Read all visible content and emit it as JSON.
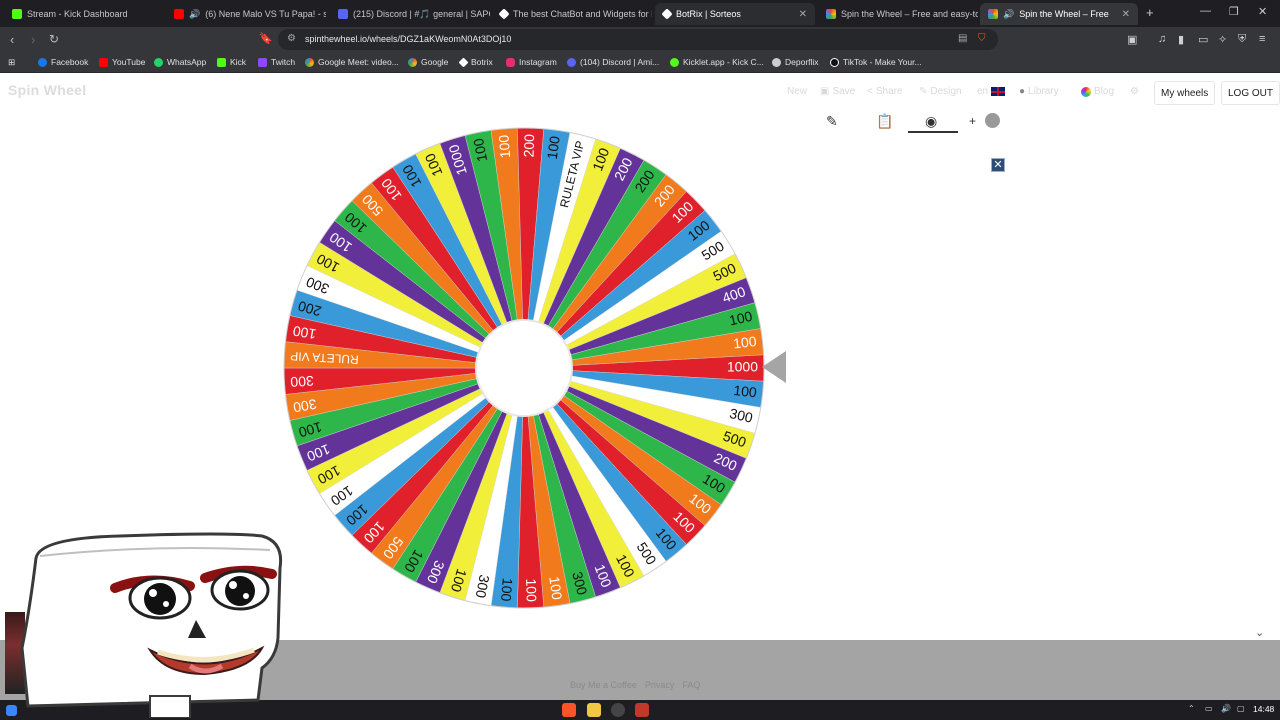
{
  "browser": {
    "tabs": [
      {
        "title": "Stream - Kick Dashboard",
        "color": "#53fc18"
      },
      {
        "title": "(6) Nene Malo VS Tu Papa! - sus",
        "color": "#ff0000"
      },
      {
        "title": "(215) Discord | #🎵 general | SAPO",
        "color": "#5865f2"
      },
      {
        "title": "The best ChatBot and Widgets for K",
        "color": "#ffffff"
      },
      {
        "title": "BotRix | Sorteos",
        "color": "#ffffff"
      },
      {
        "title": "Spin the Wheel – Free and easy-to-u",
        "color": "#4285f4"
      },
      {
        "title": "Spin the Wheel – Free and e",
        "color": "#ea4335"
      }
    ],
    "url": "spinthewheel.io/wheels/DGZ1aKWeomN0At3DOj10",
    "bookmarks": [
      {
        "label": "Facebook",
        "color": "#1877f2"
      },
      {
        "label": "YouTube",
        "color": "#ff0000"
      },
      {
        "label": "WhatsApp",
        "color": "#25d366"
      },
      {
        "label": "Kick",
        "color": "#53fc18"
      },
      {
        "label": "Twitch",
        "color": "#9146ff"
      },
      {
        "label": "Google Meet: video...",
        "color": "#00897b"
      },
      {
        "label": "Google",
        "color": "#4285f4"
      },
      {
        "label": "Botrix",
        "color": "#ffffff"
      },
      {
        "label": "Instagram",
        "color": "#e1306c"
      },
      {
        "label": "(104) Discord | Ami...",
        "color": "#5865f2"
      },
      {
        "label": "Kicklet.app - Kick C...",
        "color": "#53fc18"
      },
      {
        "label": "Deporflix",
        "color": "#cccccc"
      },
      {
        "label": "TikTok - Make Your...",
        "color": "#ffffff"
      }
    ]
  },
  "site": {
    "logo": "Spin Wheel",
    "menu": {
      "new": "New",
      "save": "Save",
      "share": "Share",
      "design": "Design",
      "lang": "en",
      "library": "Library",
      "blog": "Blog"
    },
    "my_wheels": "My wheels",
    "log_out": "LOG OUT",
    "footer": {
      "coffee": "Buy Me a Coffee",
      "privacy": "Privacy",
      "faq": "FAQ"
    }
  },
  "taskbar": {
    "time": "14:48"
  },
  "wheel": {
    "segments": [
      {
        "label": "1000",
        "color": "#e0202a"
      },
      {
        "label": "100",
        "color": "#3a9ad9"
      },
      {
        "label": "300",
        "color": "#ffffff"
      },
      {
        "label": "500",
        "color": "#f2ef3a"
      },
      {
        "label": "200",
        "color": "#63339a"
      },
      {
        "label": "100",
        "color": "#2fb64a"
      },
      {
        "label": "100",
        "color": "#f07a1c"
      },
      {
        "label": "100",
        "color": "#e0202a"
      },
      {
        "label": "100",
        "color": "#3a9ad9"
      },
      {
        "label": "500",
        "color": "#ffffff"
      },
      {
        "label": "100",
        "color": "#f2ef3a"
      },
      {
        "label": "100",
        "color": "#63339a"
      },
      {
        "label": "300",
        "color": "#2fb64a"
      },
      {
        "label": "100",
        "color": "#f07a1c"
      },
      {
        "label": "100",
        "color": "#e0202a"
      },
      {
        "label": "100",
        "color": "#3a9ad9"
      },
      {
        "label": "300",
        "color": "#ffffff"
      },
      {
        "label": "100",
        "color": "#f2ef3a"
      },
      {
        "label": "300",
        "color": "#63339a"
      },
      {
        "label": "100",
        "color": "#2fb64a"
      },
      {
        "label": "500",
        "color": "#f07a1c"
      },
      {
        "label": "100",
        "color": "#e0202a"
      },
      {
        "label": "100",
        "color": "#3a9ad9"
      },
      {
        "label": "100",
        "color": "#ffffff"
      },
      {
        "label": "100",
        "color": "#f2ef3a"
      },
      {
        "label": "100",
        "color": "#63339a"
      },
      {
        "label": "100",
        "color": "#2fb64a"
      },
      {
        "label": "300",
        "color": "#f07a1c"
      },
      {
        "label": "300",
        "color": "#e0202a"
      },
      {
        "label": "RULETA VIP",
        "color": "#f07a1c"
      },
      {
        "label": "100",
        "color": "#e0202a"
      },
      {
        "label": "200",
        "color": "#3a9ad9"
      },
      {
        "label": "300",
        "color": "#ffffff"
      },
      {
        "label": "100",
        "color": "#f2ef3a"
      },
      {
        "label": "100",
        "color": "#63339a"
      },
      {
        "label": "100",
        "color": "#2fb64a"
      },
      {
        "label": "500",
        "color": "#f07a1c"
      },
      {
        "label": "100",
        "color": "#e0202a"
      },
      {
        "label": "100",
        "color": "#3a9ad9"
      },
      {
        "label": "100",
        "color": "#f2ef3a"
      },
      {
        "label": "1000",
        "color": "#63339a"
      },
      {
        "label": "100",
        "color": "#2fb64a"
      },
      {
        "label": "100",
        "color": "#f07a1c"
      },
      {
        "label": "200",
        "color": "#e0202a"
      },
      {
        "label": "100",
        "color": "#3a9ad9"
      },
      {
        "label": "RULETA VIP",
        "color": "#ffffff"
      },
      {
        "label": "100",
        "color": "#f2ef3a"
      },
      {
        "label": "200",
        "color": "#63339a"
      },
      {
        "label": "200",
        "color": "#2fb64a"
      },
      {
        "label": "200",
        "color": "#f07a1c"
      },
      {
        "label": "100",
        "color": "#e0202a"
      },
      {
        "label": "100",
        "color": "#3a9ad9"
      },
      {
        "label": "500",
        "color": "#ffffff"
      },
      {
        "label": "500",
        "color": "#f2ef3a"
      },
      {
        "label": "400",
        "color": "#63339a"
      },
      {
        "label": "100",
        "color": "#2fb64a"
      },
      {
        "label": "100",
        "color": "#f07a1c"
      }
    ]
  }
}
